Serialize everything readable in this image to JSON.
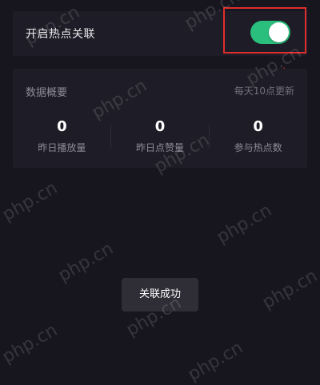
{
  "hotspot_link": {
    "label": "开启热点关联",
    "toggle_on": true
  },
  "overview": {
    "title": "数据概要",
    "update_note": "每天10点更新",
    "stats": [
      {
        "value": "0",
        "label": "昨日播放量"
      },
      {
        "value": "0",
        "label": "昨日点赞量"
      },
      {
        "value": "0",
        "label": "参与热点数"
      }
    ]
  },
  "toast": {
    "message": "关联成功"
  },
  "watermark": {
    "text": "php.cn"
  },
  "colors": {
    "background": "#17161f",
    "card": "#1e1d27",
    "toggle_on": "#2bbf7e",
    "highlight": "#e02d2d"
  }
}
